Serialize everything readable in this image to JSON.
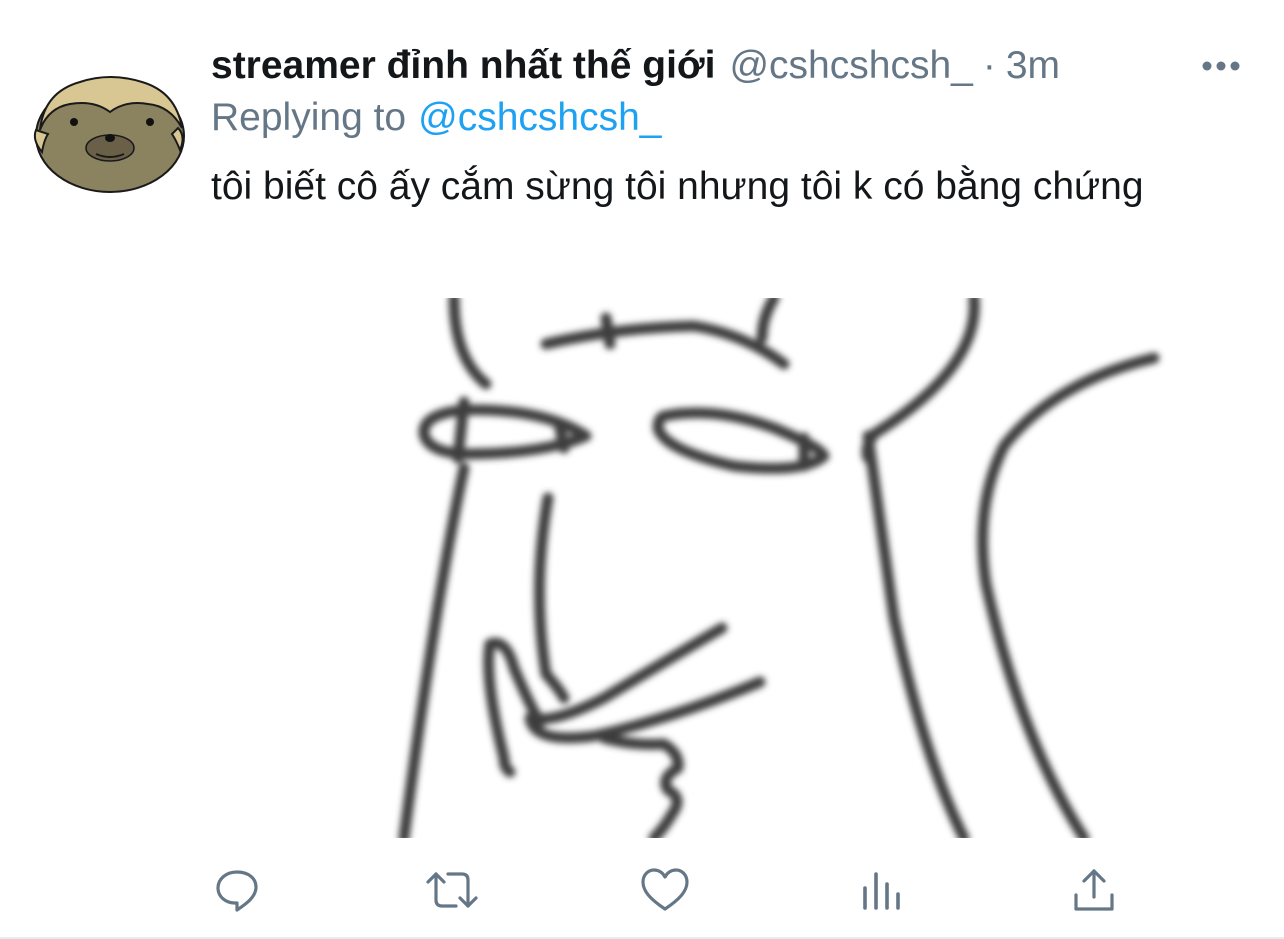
{
  "tweet": {
    "display_name": "streamer đỉnh nhất thế giới",
    "handle": "@cshcshcsh_",
    "separator": "·",
    "time": "3m",
    "reply_prefix": "Replying to",
    "reply_handle": "@cshcshcsh_",
    "text": "tôi biết cô ấy cắm sừng tôi nhưng tôi k có bằng chứng"
  },
  "icons": {
    "more": "more-dots-icon",
    "reply": "reply-icon",
    "retweet": "retweet-icon",
    "like": "like-icon",
    "analytics": "analytics-icon",
    "share": "share-icon"
  },
  "colors": {
    "text": "#14171a",
    "secondary": "#657786",
    "link": "#1da1f2",
    "icon": "#657786",
    "avatar_fur": "#8b8260",
    "avatar_mask": "#d8c693"
  }
}
